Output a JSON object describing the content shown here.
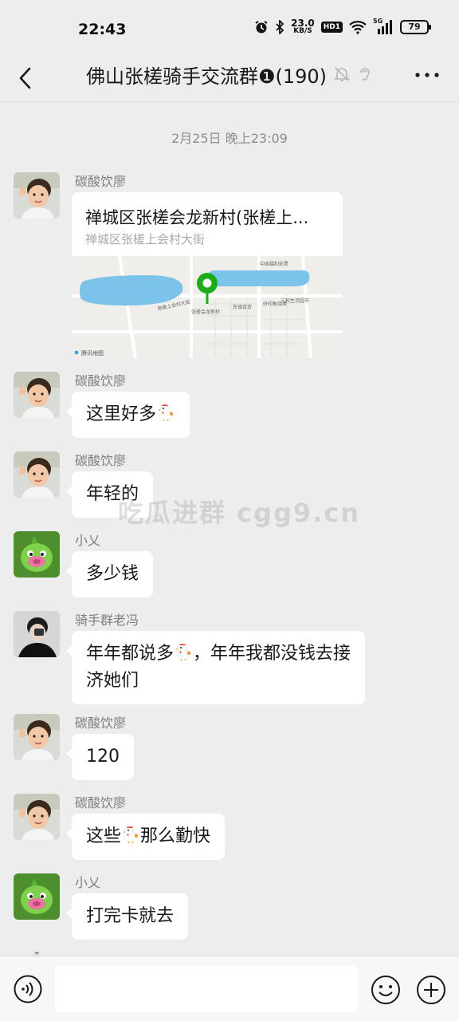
{
  "status_bar": {
    "time": "22:43",
    "network_speed_value": "23.0",
    "network_speed_unit": "KB/S",
    "hd_label": "HD1",
    "signal_label": "5G",
    "battery": "79"
  },
  "header": {
    "title": "佛山张槎骑手交流群❶(190)",
    "icons": [
      "back-icon",
      "mute-bell-icon",
      "ear-icon",
      "more-icon"
    ]
  },
  "timestamp": "2月25日 晚上23:09",
  "messages": [
    {
      "sender": "碳酸饮廖",
      "type": "location",
      "title": "禅城区张槎会龙新村(张槎上...",
      "address": "禅城区张槎上会村大街",
      "map_labels": [
        "中国福利彩票",
        "张槎上会村大街",
        "张槎会龙新村",
        "好印象烧烤",
        "东镇百货",
        "三和生活超市",
        "腾讯地图"
      ]
    },
    {
      "sender": "碳酸饮廖",
      "type": "text",
      "parts": [
        "这里好多",
        "chicken",
        ""
      ]
    },
    {
      "sender": "碳酸饮廖",
      "type": "text",
      "text": "年轻的"
    },
    {
      "sender": "小乂",
      "type": "text",
      "text": "多少钱"
    },
    {
      "sender": "骑手群老冯",
      "type": "text",
      "line1_parts": [
        "年年都说多",
        "chicken",
        "，年年我都没钱去接"
      ],
      "line2": "济她们"
    },
    {
      "sender": "碳酸饮廖",
      "type": "text",
      "text": "120"
    },
    {
      "sender": "碳酸饮廖",
      "type": "text",
      "parts": [
        "这些",
        "chicken",
        "那么勤快"
      ]
    },
    {
      "sender": "小乂",
      "type": "text",
      "text": "打完卡就去"
    }
  ],
  "watermark": "吃瓜进群 cgg9.cn",
  "input_bar": {
    "placeholder": "",
    "icons": [
      "voice-icon",
      "emoji-icon",
      "plus-icon"
    ]
  },
  "colors": {
    "background": "#ededed",
    "bubble": "#ffffff",
    "map_pin": "#1aad19",
    "water": "#7cc3ea"
  }
}
